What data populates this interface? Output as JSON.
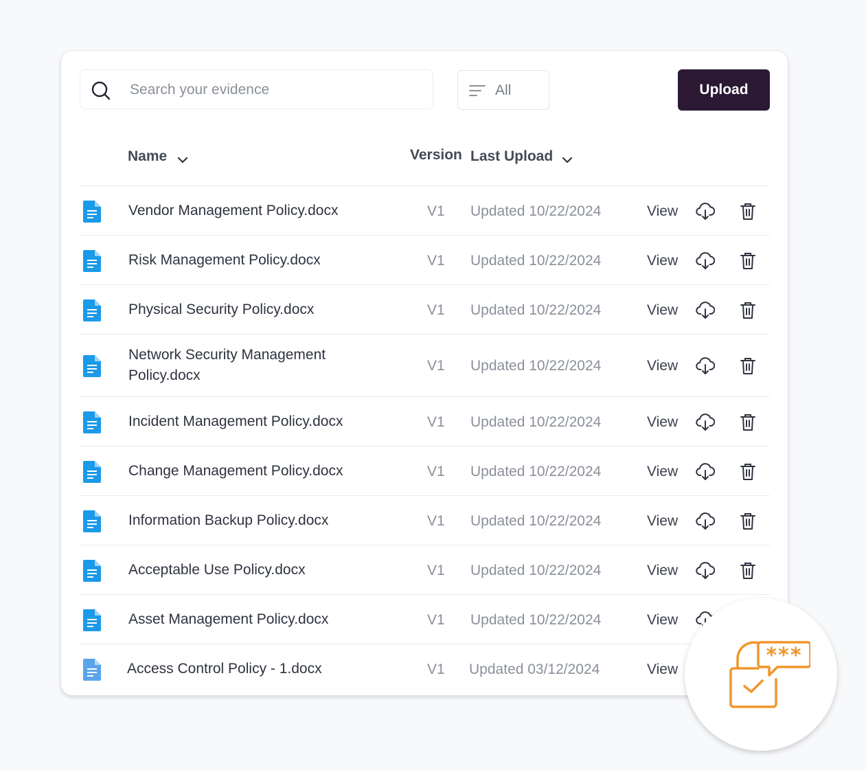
{
  "search": {
    "placeholder": "Search your evidence"
  },
  "filter": {
    "label": "All"
  },
  "upload": {
    "label": "Upload"
  },
  "columns": {
    "name": "Name",
    "version": "Version",
    "last_upload": "Last Upload"
  },
  "rows": [
    {
      "name": "Vendor Management Policy.docx",
      "version": "V1",
      "updated": "Updated 10/22/2024",
      "view": "View"
    },
    {
      "name": "Risk Management Policy.docx",
      "version": "V1",
      "updated": "Updated 10/22/2024",
      "view": "View"
    },
    {
      "name": "Physical Security Policy.docx",
      "version": "V1",
      "updated": "Updated 10/22/2024",
      "view": "View"
    },
    {
      "name": "Network Security Management Policy.docx",
      "version": "V1",
      "updated": "Updated 10/22/2024",
      "view": "View"
    },
    {
      "name": "Incident Management Policy.docx",
      "version": "V1",
      "updated": "Updated 10/22/2024",
      "view": "View"
    },
    {
      "name": "Change Management Policy.docx",
      "version": "V1",
      "updated": "Updated 10/22/2024",
      "view": "View"
    },
    {
      "name": "Information Backup Policy.docx",
      "version": "V1",
      "updated": "Updated 10/22/2024",
      "view": "View"
    },
    {
      "name": "Acceptable Use Policy.docx",
      "version": "V1",
      "updated": "Updated 10/22/2024",
      "view": "View"
    },
    {
      "name": "Asset Management Policy.docx",
      "version": "V1",
      "updated": "Updated 10/22/2024",
      "view": "View"
    },
    {
      "name": "Access Control Policy - 1.docx",
      "version": "V1",
      "updated": "Updated 03/12/2024",
      "view": "View"
    }
  ],
  "icons": {
    "search": "search-icon",
    "filter": "filter-lines-icon",
    "sort": "chevron-down-icon",
    "file": "document-icon",
    "download": "cloud-download-icon",
    "delete": "trash-icon",
    "badge": "lock-password-chat-icon"
  },
  "colors": {
    "upload_bg": "#2b1934",
    "file_icon": "#1a9ae8",
    "file_icon_last": "#5aa5ea",
    "badge_icon": "#f0962c"
  }
}
